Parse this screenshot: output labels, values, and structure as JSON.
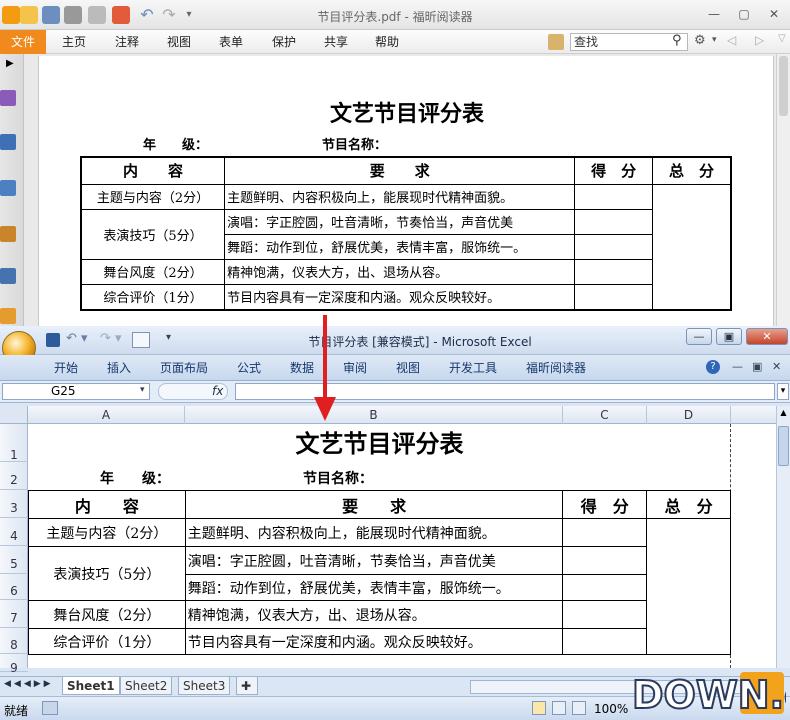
{
  "pdf_reader": {
    "window_title": "节目评分表.pdf - 福昕阅读器",
    "file_tab": "文件",
    "menu": [
      "主页",
      "注释",
      "视图",
      "表单",
      "保护",
      "共享",
      "帮助"
    ],
    "search_placeholder": "查找",
    "table_title": "文艺节目评分表",
    "grade_label": "年　　级：",
    "program_label": "节目名称：",
    "headers": [
      "内　　容",
      "要　　求",
      "得　分",
      "总　分"
    ],
    "rows": [
      {
        "content": "主题与内容（2分）",
        "requirement": "主题鲜明、内容积极向上，能展现时代精神面貌。"
      },
      {
        "content": "表演技巧（5分）",
        "requirement": "演唱：字正腔圆，吐音清晰，节奏恰当，声音优美"
      },
      {
        "content": "",
        "requirement": "舞蹈：动作到位，舒展优美，表情丰富，服饰统一。"
      },
      {
        "content": "舞台风度（2分）",
        "requirement": "精神饱满，仪表大方，出、退场从容。"
      },
      {
        "content": "综合评价（1分）",
        "requirement": "节目内容具有一定深度和内涵。观众反映较好。"
      }
    ]
  },
  "excel": {
    "window_title": "节目评分表 [兼容模式] - Microsoft Excel",
    "ribbon_tabs": [
      "开始",
      "插入",
      "页面布局",
      "公式",
      "数据",
      "审阅",
      "视图",
      "开发工具",
      "福昕阅读器"
    ],
    "name_box": "G25",
    "fx_label": "fx",
    "columns": [
      "A",
      "B",
      "C",
      "D"
    ],
    "row_numbers": [
      "1",
      "2",
      "3",
      "4",
      "5",
      "6",
      "7",
      "8",
      "9"
    ],
    "sheet_tabs": [
      "Sheet1",
      "Sheet2",
      "Sheet3"
    ],
    "status_ready": "就绪",
    "zoom": "100%"
  },
  "watermark": {
    "text": "DOWN.cc"
  },
  "colors": {
    "pdf_accent": "#f08a1c",
    "excel_blue": "#c7d8ee",
    "arrow_red": "#e02020"
  }
}
